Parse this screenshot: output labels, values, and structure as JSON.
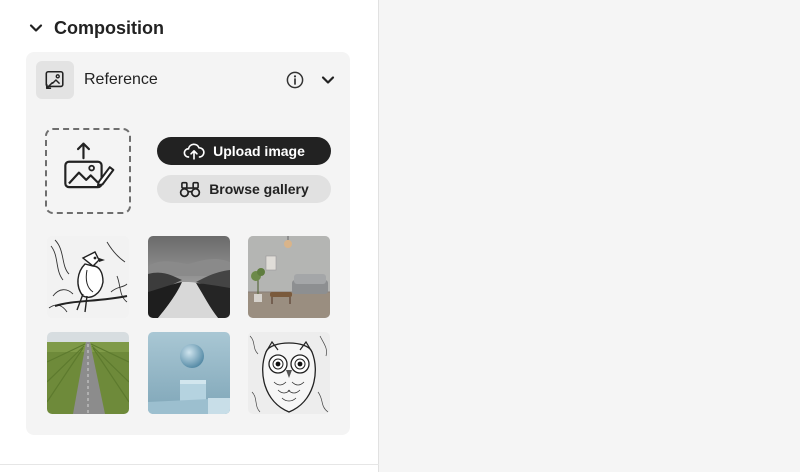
{
  "section": {
    "title": "Composition",
    "collapse_icon": "chevron-down-icon"
  },
  "reference": {
    "label": "Reference",
    "icon": "image-reference-icon",
    "info_icon": "info-icon",
    "expand_icon": "chevron-down-icon"
  },
  "upload": {
    "dropzone_icon": "image-upload-icon",
    "upload_label": "Upload image",
    "upload_icon": "cloud-upload-icon",
    "browse_label": "Browse gallery",
    "browse_icon": "binoculars-icon"
  },
  "gallery": {
    "thumbnails": [
      {
        "subject": "bird line art"
      },
      {
        "subject": "misty river valley"
      },
      {
        "subject": "living room interior"
      },
      {
        "subject": "straight road through fields"
      },
      {
        "subject": "sphere on blocks"
      },
      {
        "subject": "owl pattern line art"
      }
    ]
  },
  "colors": {
    "primary_button": "#222222",
    "secondary_button": "#e1e1e1",
    "card_bg": "#f4f4f4",
    "canvas_bg": "#f5f5f5"
  }
}
